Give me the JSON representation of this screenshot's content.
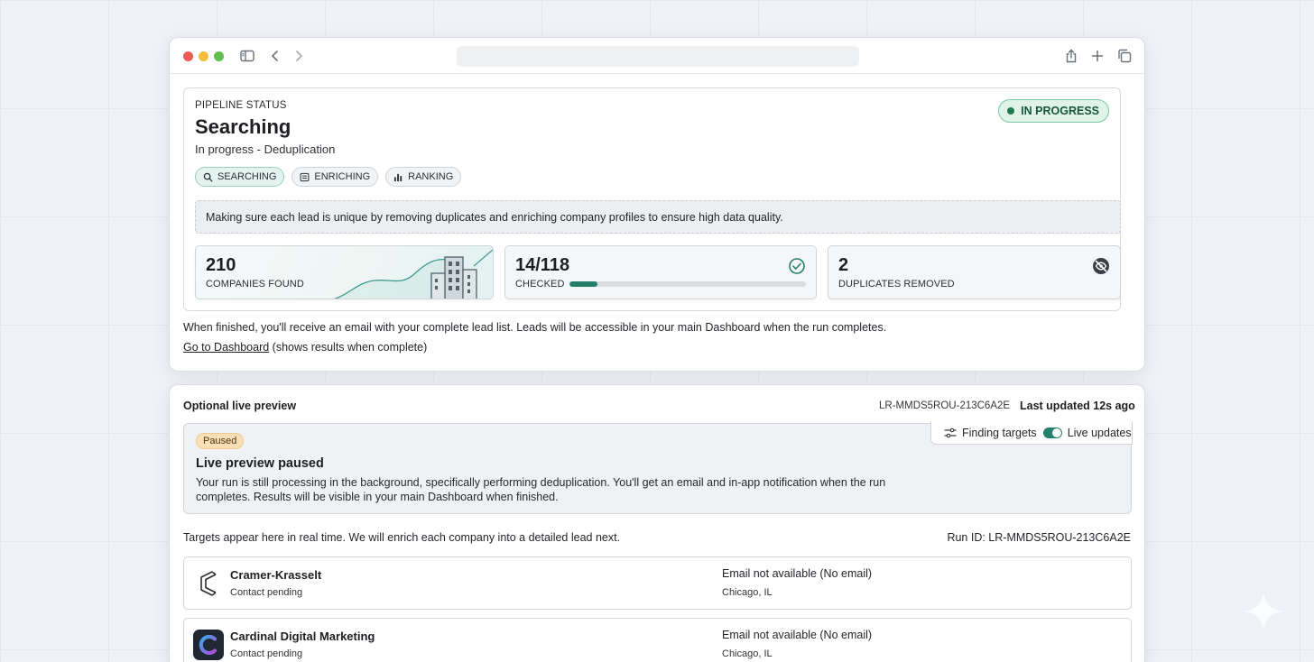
{
  "browser": {
    "address": "",
    "icons": [
      "sidebar-icon",
      "back-arrow-icon",
      "forward-arrow-icon",
      "share-icon",
      "plus-icon",
      "tabs-icon"
    ]
  },
  "pipeline": {
    "eyebrow": "PIPELINE STATUS",
    "title": "Searching",
    "subtitle": "In progress - Deduplication",
    "status_pill": "IN PROGRESS",
    "stages": [
      {
        "label": "SEARCHING",
        "icon": "search-icon",
        "active": true
      },
      {
        "label": "ENRICHING",
        "icon": "list-icon",
        "active": false
      },
      {
        "label": "RANKING",
        "icon": "bar-chart-icon",
        "active": false
      }
    ],
    "info_banner": "Making sure each lead is unique by removing duplicates and enriching company profiles to ensure high data quality.",
    "stats": {
      "companies": {
        "value": "210",
        "label": "COMPANIES FOUND"
      },
      "checked": {
        "value": "14/118",
        "label": "CHECKED",
        "progress_fraction": 0.1186
      },
      "duplicates": {
        "value": "2",
        "label": "DUPLICATES REMOVED"
      }
    },
    "footer_line1": "When finished, you'll receive an email with your complete lead list. Leads will be accessible in your main Dashboard when the run completes.",
    "dashboard_link": "Go to Dashboard",
    "dashboard_note": " (shows results when complete)"
  },
  "preview": {
    "heading": "Optional live preview",
    "run_id_short": "LR-MMDS5ROU-213C6A2E",
    "last_updated": "Last updated 12s ago",
    "controls": {
      "finding_targets": "Finding targets",
      "live_updates": "Live updates",
      "live_updates_on": true
    },
    "paused_badge": "Paused",
    "paused_title": "Live preview paused",
    "paused_body": "Your run is still processing in the background, specifically performing deduplication. You'll get an email and in-app notification when the run completes. Results will be visible in your main Dashboard when finished.",
    "targets_note": "Targets appear here in real time. We will enrich each company into a detailed lead next.",
    "run_id_label": "Run ID: LR-MMDS5ROU-213C6A2E",
    "targets": [
      {
        "name": "Cramer-Krasselt",
        "contact": "Contact pending",
        "email": "Email not available (No email)",
        "location": "Chicago, IL"
      },
      {
        "name": "Cardinal Digital Marketing",
        "contact": "Contact pending",
        "email": "Email not available (No email)",
        "location": "Chicago, IL"
      }
    ]
  },
  "colors": {
    "accent": "#25806a",
    "in_progress_bg": "#dff3e8",
    "paused_badge_bg": "#f9dfb6"
  }
}
